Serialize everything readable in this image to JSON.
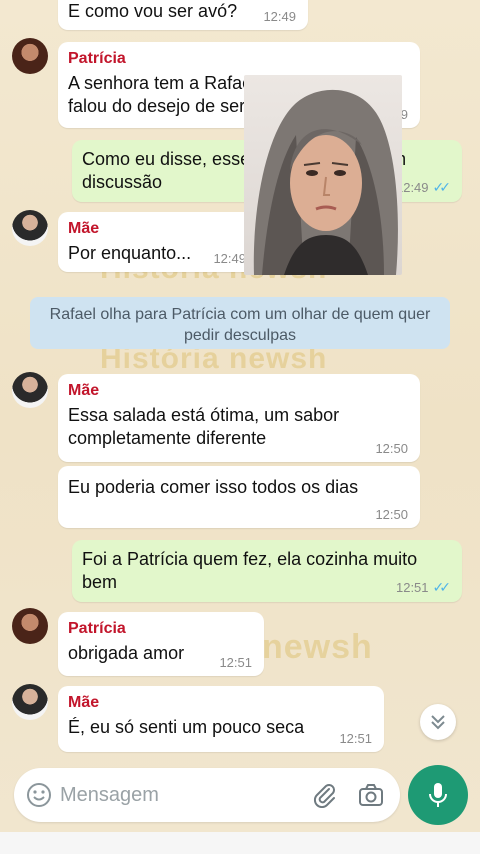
{
  "watermark": {
    "text_1": "História newsh",
    "text_2": "História newsh",
    "text_3": "newsh"
  },
  "messages": [
    {
      "text": "E como vou ser avó?",
      "time": "12:49"
    },
    {
      "sender": "Patrícia",
      "line1": "A senhora tem a Rafaela e ela sempre",
      "line2": "falou do desejo de ser mãe",
      "time": "12:49"
    },
    {
      "line1": "Como eu disse, esse assunto já está em",
      "line2": "discussão",
      "time": "12:49"
    },
    {
      "sender": "Mãe",
      "text": "Por enquanto...",
      "time": "12:49"
    },
    {
      "sender": "Mãe",
      "line1": "Essa salada está ótima, um sabor",
      "line2": "completamente diferente",
      "time": "12:50"
    },
    {
      "text": "Eu poderia comer isso todos os dias",
      "time": "12:50"
    },
    {
      "line1": "Foi a Patrícia quem fez, ela cozinha muito",
      "line2": "bem",
      "time": "12:51"
    },
    {
      "sender": "Patrícia",
      "text": "obrigada amor",
      "time": "12:51"
    },
    {
      "sender": "Mãe",
      "text": "É, eu só senti um pouco seca",
      "time": "12:51"
    }
  ],
  "notice": {
    "line1": "Rafael olha para Patrícia com um olhar de quem quer",
    "line2": "pedir desculpas"
  },
  "input": {
    "placeholder": "Mensagem"
  },
  "colors": {
    "sender_name": "#c2152b",
    "outgoing_bubble": "#e2f7cb",
    "read_ticks": "#4fb3e8",
    "mic_button": "#1e9a74",
    "notice_bg": "#cfe3f1"
  },
  "icons": [
    "emoji-icon",
    "attach-icon",
    "camera-icon",
    "mic-icon",
    "chevron-double-down-icon",
    "read-ticks-icon"
  ]
}
